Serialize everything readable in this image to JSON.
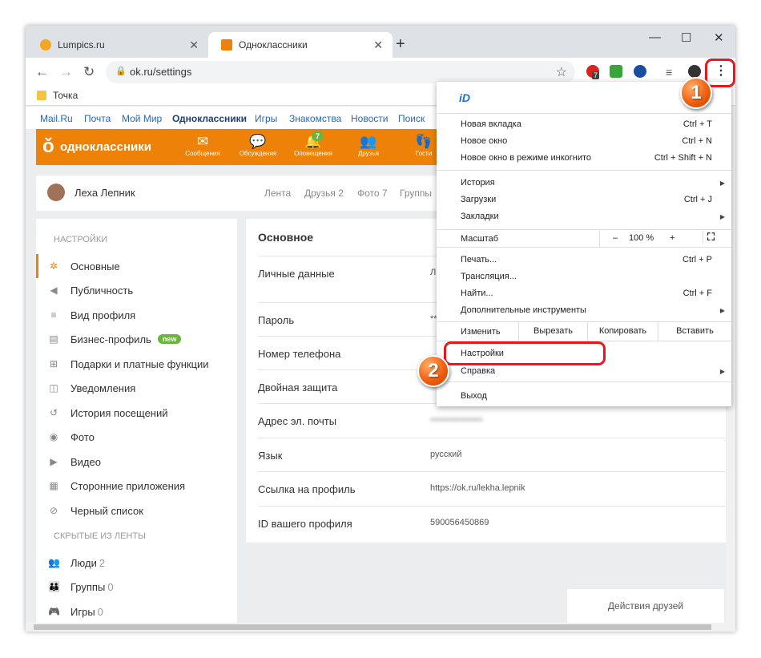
{
  "browser": {
    "tabs": [
      {
        "label": "Lumpics.ru",
        "active": false,
        "favicon_color": "#f5a623"
      },
      {
        "label": "Одноклассники",
        "active": true,
        "favicon_color": "#ee8208"
      }
    ],
    "url": "ok.ru/settings",
    "extension_badges": [
      "7"
    ],
    "bookmark": "Точка"
  },
  "portal_links": [
    "Mail.Ru",
    "Почта",
    "Мой Мир",
    "Одноклассники",
    "Игры",
    "Знакомства",
    "Новости",
    "Поиск"
  ],
  "ok_header": {
    "logo_text": "одноклассники",
    "nav": [
      {
        "label": "Сообщения",
        "icon": "envelope-icon"
      },
      {
        "label": "Обсуждения",
        "icon": "chat-icon"
      },
      {
        "label": "Оповещения",
        "icon": "bell-icon"
      },
      {
        "label": "Друзья",
        "icon": "people-icon"
      },
      {
        "label": "Гости",
        "icon": "footprints-icon"
      }
    ],
    "notifications_count": "7"
  },
  "profile": {
    "name": "Леха Лепник",
    "tabs": [
      "Лента",
      "Друзья 2",
      "Фото 7",
      "Группы"
    ]
  },
  "sidebar": {
    "header": "НАСТРОЙКИ",
    "items": [
      {
        "label": "Основные",
        "icon": "gear-icon",
        "active": true
      },
      {
        "label": "Публичность",
        "icon": "megaphone-icon"
      },
      {
        "label": "Вид профиля",
        "icon": "list-icon"
      },
      {
        "label": "Бизнес-профиль",
        "icon": "business-icon",
        "badge": "new"
      },
      {
        "label": "Подарки и платные функции",
        "icon": "gift-icon"
      },
      {
        "label": "Уведомления",
        "icon": "bell-icon"
      },
      {
        "label": "История посещений",
        "icon": "history-icon"
      },
      {
        "label": "Фото",
        "icon": "camera-icon"
      },
      {
        "label": "Видео",
        "icon": "video-icon"
      },
      {
        "label": "Сторонние приложения",
        "icon": "apps-icon"
      },
      {
        "label": "Черный список",
        "icon": "blocked-user-icon"
      }
    ],
    "hidden_header": "СКРЫТЫЕ ИЗ ЛЕНТЫ",
    "hidden_items": [
      {
        "label": "Люди",
        "count": "2",
        "icon": "people-icon"
      },
      {
        "label": "Группы",
        "count": "0",
        "icon": "group-icon"
      },
      {
        "label": "Игры",
        "count": "0",
        "icon": "gamepad-icon"
      }
    ]
  },
  "settings": {
    "title": "Основное",
    "rows": [
      {
        "key": "Личные данные",
        "value": "Л"
      },
      {
        "key": "Пароль",
        "value": "**"
      },
      {
        "key": "Номер телефона",
        "value": ""
      },
      {
        "key": "Двойная защита",
        "value": ""
      },
      {
        "key": "Адрес эл. почты",
        "value": "",
        "blurred": true
      },
      {
        "key": "Язык",
        "value": "русский"
      },
      {
        "key": "Ссылка на профиль",
        "value": "https://ok.ru/lekha.lepnik"
      },
      {
        "key": "ID вашего профиля",
        "value": "590056450869"
      }
    ]
  },
  "friends_actions": "Действия друзей",
  "chrome_menu": {
    "logo": "iD",
    "group1": [
      {
        "label": "Новая вкладка",
        "shortcut": "Ctrl + T"
      },
      {
        "label": "Новое окно",
        "shortcut": "Ctrl + N"
      },
      {
        "label": "Новое окно в режиме инкогнито",
        "shortcut": "Ctrl + Shift + N"
      }
    ],
    "group2": [
      {
        "label": "История",
        "submenu": true
      },
      {
        "label": "Загрузки",
        "shortcut": "Ctrl + J"
      },
      {
        "label": "Закладки",
        "submenu": true
      }
    ],
    "zoom_label": "Масштаб",
    "zoom_minus": "–",
    "zoom_value": "100 %",
    "zoom_plus": "+",
    "group3": [
      {
        "label": "Печать...",
        "shortcut": "Ctrl + P"
      },
      {
        "label": "Трансляция..."
      },
      {
        "label": "Найти...",
        "shortcut": "Ctrl + F"
      },
      {
        "label": "Дополнительные инструменты",
        "submenu": true
      }
    ],
    "edit_label": "Изменить",
    "edit_buttons": [
      "Вырезать",
      "Копировать",
      "Вставить"
    ],
    "settings": "Настройки",
    "help": "Справка",
    "exit": "Выход"
  },
  "annotations": {
    "step1": "1",
    "step2": "2",
    "highlight_color": "#e8171b"
  }
}
